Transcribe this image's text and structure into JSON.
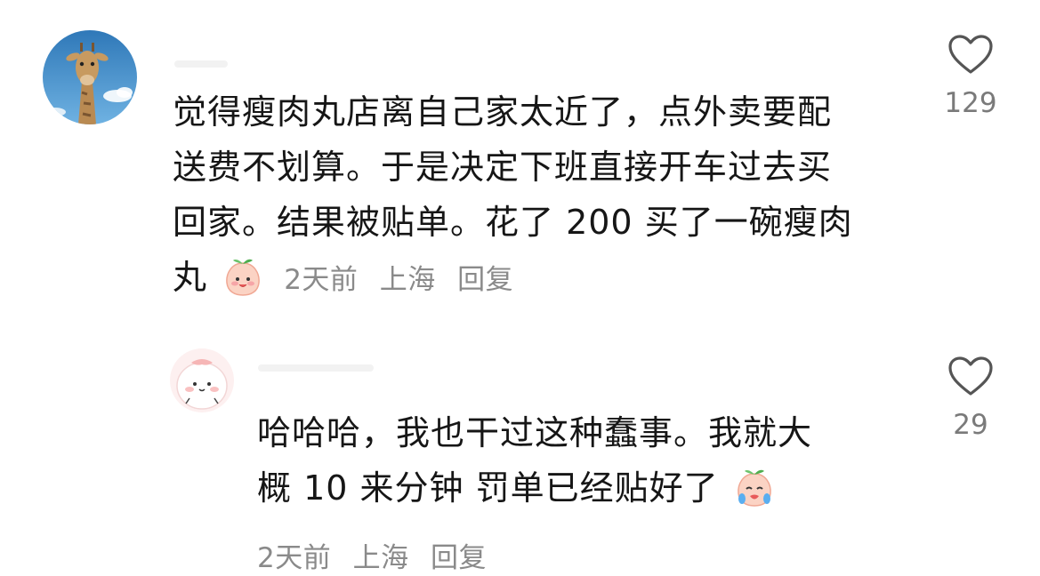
{
  "comments": [
    {
      "text_lines": [
        "觉得瘦肉丸店离自己家太近了，点外卖要配",
        "送费不划算。于是决定下班直接开车过去买",
        "回家。结果被贴单。花了 200 买了一碗瘦肉",
        "丸"
      ],
      "emoji": "smiling-peach-emoji",
      "time": "2天前",
      "location": "上海",
      "reply_label": "回复",
      "like_count": "129",
      "avatar": "giraffe-avatar"
    },
    {
      "text_lines": [
        "哈哈哈，我也干过这种蠢事。我就大",
        "概 10 来分钟 罚单已经贴好了"
      ],
      "emoji": "crying-peach-emoji",
      "time": "2天前",
      "location": "上海",
      "reply_label": "回复",
      "like_count": "29",
      "avatar": "cartoon-peach-avatar"
    }
  ],
  "colors": {
    "text": "#161616",
    "meta": "#8a8a8a",
    "like_icon": "#555555"
  }
}
